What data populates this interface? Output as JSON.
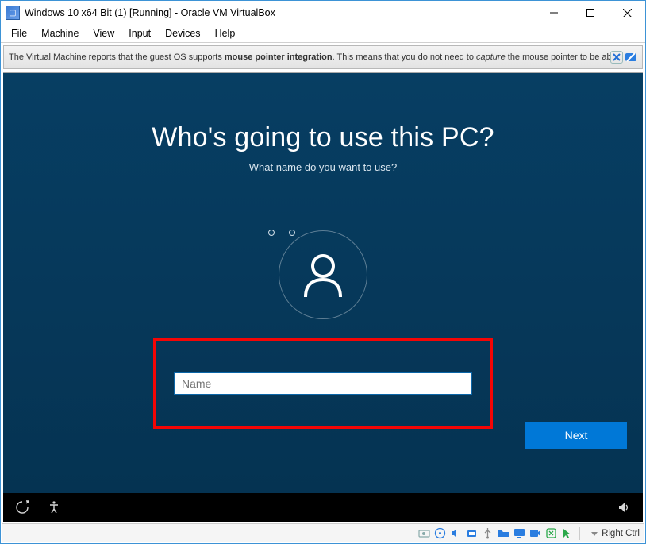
{
  "window": {
    "title": "Windows 10 x64 Bit (1) [Running] - Oracle VM VirtualBox"
  },
  "menu": {
    "items": [
      "File",
      "Machine",
      "View",
      "Input",
      "Devices",
      "Help"
    ]
  },
  "notification": {
    "prefix": "The Virtual Machine reports that the guest OS supports ",
    "bold": "mouse pointer integration",
    "middle": ". This means that you do not need to ",
    "italic": "capture",
    "suffix": " the mouse pointer to be able to"
  },
  "oobe": {
    "heading": "Who's going to use this PC?",
    "subheading": "What name do you want to use?",
    "name_placeholder": "Name",
    "name_value": "",
    "next_label": "Next"
  },
  "statusbar": {
    "host_key": "Right Ctrl"
  }
}
